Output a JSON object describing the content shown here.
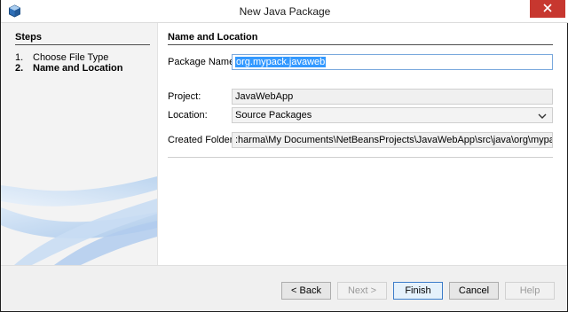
{
  "window": {
    "title": "New Java Package"
  },
  "steps": {
    "title": "Steps",
    "items": [
      {
        "num": "1.",
        "label": "Choose File Type"
      },
      {
        "num": "2.",
        "label": "Name and Location"
      }
    ]
  },
  "form": {
    "title": "Name and Location",
    "package_name_label": "Package Name:",
    "package_name_value": "org.mypack.javaweb",
    "project_label": "Project:",
    "project_value": "JavaWebApp",
    "location_label": "Location:",
    "location_value": "Source Packages",
    "created_folder_label": "Created Folder:",
    "created_folder_value": ":harma\\My Documents\\NetBeansProjects\\JavaWebApp\\src\\java\\org\\mypack\\javaweb"
  },
  "buttons": {
    "back": "< Back",
    "next": "Next >",
    "finish": "Finish",
    "cancel": "Cancel",
    "help": "Help"
  },
  "icons": {
    "app": "netbeans-cube-icon",
    "close": "close-icon",
    "location_dropdown": "chevron-down-icon"
  },
  "colors": {
    "close_red": "#c7372f",
    "selection_blue": "#3399ff",
    "default_button_border": "#3b7cc9"
  }
}
